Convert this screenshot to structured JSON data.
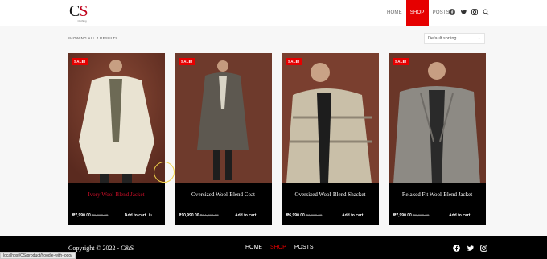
{
  "header": {
    "logo_text_c": "C",
    "logo_text_s": "S",
    "logo_sub": "Clothing",
    "nav": [
      {
        "label": "HOME",
        "active": false
      },
      {
        "label": "SHOP",
        "active": true
      },
      {
        "label": "POSTS",
        "active": false
      }
    ],
    "social_icons": [
      "facebook-icon",
      "twitter-icon",
      "instagram-icon",
      "search-icon"
    ]
  },
  "shop": {
    "result_count": "SHOWING ALL 4 RESULTS",
    "sorting": "Default sorting"
  },
  "products": [
    {
      "badge": "SALE!",
      "title": "Ivory Wool-Blend Jacket",
      "price": "₱7,990.00",
      "old_price": "₱9,990.00",
      "cart": "Add to cart",
      "hover": true
    },
    {
      "badge": "SALE!",
      "title": "Oversized Wool-Blend Coat",
      "price": "₱10,990.00",
      "old_price": "₱14,990.00",
      "cart": "Add to cart",
      "hover": false
    },
    {
      "badge": "SALE!",
      "title": "Oversized Wool-Blend Shacket",
      "price": "₱6,990.00",
      "old_price": "₱7,990.00",
      "cart": "Add to cart",
      "hover": false
    },
    {
      "badge": "SALE!",
      "title": "Relaxed Fit Wool-Blend Jacket",
      "price": "₱7,990.00",
      "old_price": "₱9,990.00",
      "cart": "Add to cart",
      "hover": false
    }
  ],
  "footer": {
    "copyright": "Copyright © 2022 - C&S",
    "nav": [
      {
        "label": "HOME",
        "active": false
      },
      {
        "label": "SHOP",
        "active": true
      },
      {
        "label": "POSTS",
        "active": false
      }
    ],
    "social_icons": [
      "facebook-icon",
      "twitter-icon",
      "instagram-icon"
    ]
  },
  "status_url": "localhost/CS/product/hoodie-with-logo/",
  "colors": {
    "accent": "#e60000",
    "photo_bg": "#6e3a2c",
    "card_bg": "#000000"
  }
}
